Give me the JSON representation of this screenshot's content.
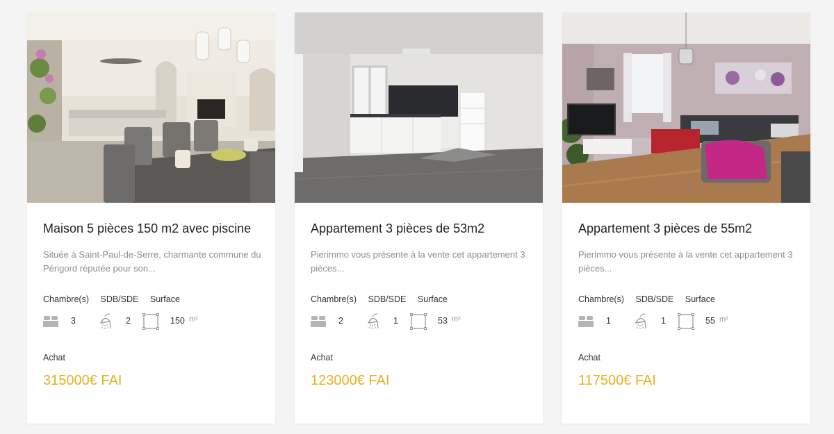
{
  "accent_color": "#e6b023",
  "listings": [
    {
      "title": "Maison 5 pièces 150 m2 avec piscine",
      "description": "Située à Saint-Paul-de-Serre, charmante commune du Périgord réputée pour son...",
      "labels": {
        "bedrooms": "Chambre(s)",
        "bathrooms": "SDB/SDE",
        "surface": "Surface"
      },
      "bedrooms": "3",
      "bathrooms": "2",
      "surface": "150",
      "surface_unit": "m²",
      "transaction": "Achat",
      "price": "315000€ FAI",
      "icons": [
        "bed-icon",
        "shower-icon",
        "surface-icon"
      ]
    },
    {
      "title": "Appartement 3 pièces de 53m2",
      "description": "Pierimmo vous présente à la vente cet appartement 3 pièces...",
      "labels": {
        "bedrooms": "Chambre(s)",
        "bathrooms": "SDB/SDE",
        "surface": "Surface"
      },
      "bedrooms": "2",
      "bathrooms": "1",
      "surface": "53",
      "surface_unit": "m²",
      "transaction": "Achat",
      "price": "123000€ FAI",
      "icons": [
        "bed-icon",
        "shower-icon",
        "surface-icon"
      ]
    },
    {
      "title": "Appartement 3 pièces de 55m2",
      "description": "Pierimmo vous présente à la vente cet appartement 3 pièces...",
      "labels": {
        "bedrooms": "Chambre(s)",
        "bathrooms": "SDB/SDE",
        "surface": "Surface"
      },
      "bedrooms": "1",
      "bathrooms": "1",
      "surface": "55",
      "surface_unit": "m²",
      "transaction": "Achat",
      "price": "117500€ FAI",
      "icons": [
        "bed-icon",
        "shower-icon",
        "surface-icon"
      ]
    }
  ]
}
